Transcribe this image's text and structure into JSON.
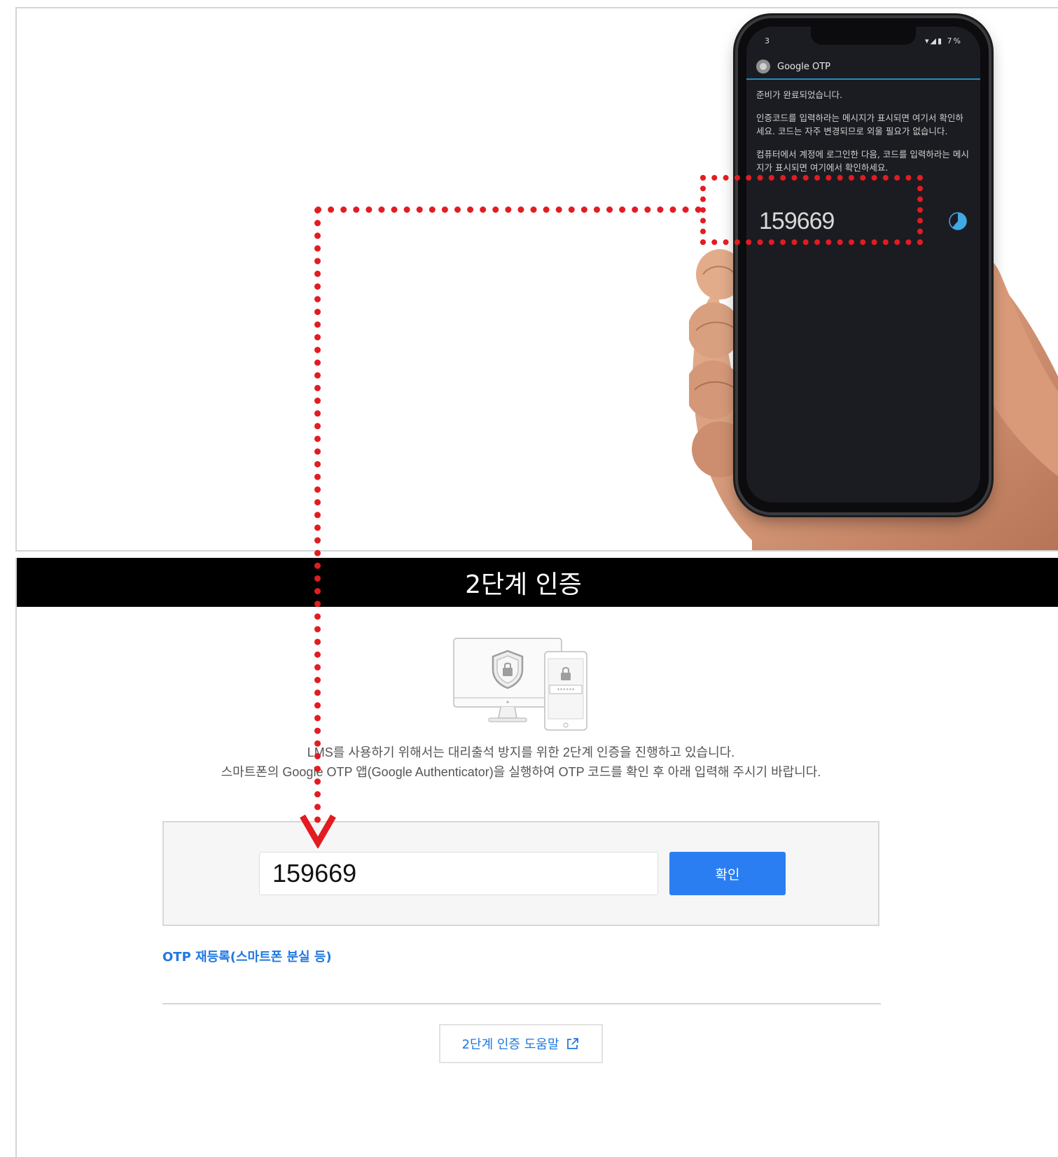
{
  "phone": {
    "status_time": "3",
    "status_icons": "▾◢▮ 7%",
    "app_title": "Google OTP",
    "text_1": "준비가 완료되었습니다.",
    "text_2": "인증코드를 입력하라는 메시지가 표시되면 여기서 확인하세요. 코드는 자주 변경되므로 외울 필요가 없습니다.",
    "text_3": "컴퓨터에서 계정에 로그인한 다음, 코드를 입력하라는 메시지가 표시되면 여기에서 확인하세요.",
    "otp_code": "159669"
  },
  "auth": {
    "title": "2단계 인증",
    "description_line1": "LMS를 사용하기 위해서는 대리출석 방지를 위한 2단계 인증을 진행하고 있습니다.",
    "description_line2": "스마트폰의 Google OTP 앱(Google Authenticator)을 실행하여 OTP 코드를 확인 후 아래 입력해 주시기 바랍니다.",
    "otp_input_value": "159669",
    "confirm_label": "확인",
    "reregister_link": "OTP 재등록(스마트폰 분실 등)",
    "help_label": "2단계 인증 도움말"
  },
  "colors": {
    "header_bg": "#000000",
    "accent_blue": "#2a7ef2",
    "callout_red": "#e21c21",
    "app_bar_line": "#2c88bf",
    "timer_blue": "#3fa9e6"
  },
  "icons": {
    "timer": "pie-timer-icon",
    "external": "external-link-icon",
    "shield": "shield-lock-icon",
    "device_lock": "device-lock-icon"
  }
}
